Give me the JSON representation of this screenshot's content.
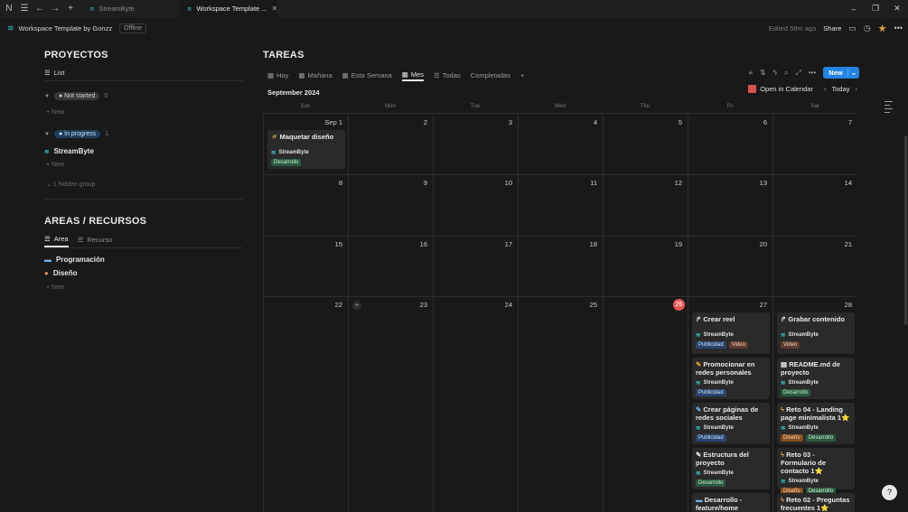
{
  "titlebar": {
    "tabs": [
      {
        "label": "StreamByte",
        "active": false
      },
      {
        "label": "Workspace Template ...",
        "active": true
      }
    ],
    "controls": [
      "–",
      "❐",
      "✕"
    ]
  },
  "header": {
    "workspace": "Workspace Template by Gonzz",
    "status": "Offline",
    "edited": "Edited 58m ago",
    "share": "Share"
  },
  "proyectos": {
    "title": "PROYECTOS",
    "view": "List",
    "groups": [
      {
        "status": "Not started",
        "count": "0",
        "items": [],
        "new": "New"
      },
      {
        "status": "In progress",
        "count": "1",
        "items": [
          "StreamByte"
        ],
        "new": "New"
      }
    ],
    "hidden": "1 hidden group"
  },
  "areas": {
    "title": "AREAS / RECURSOS",
    "tabs": [
      "Area",
      "Recurso"
    ],
    "items": [
      {
        "label": "Programación",
        "icon": "laptop-icon"
      },
      {
        "label": "Diseño",
        "icon": "palette-icon"
      }
    ],
    "new": "New"
  },
  "tareas": {
    "title": "TAREAS",
    "tabs": [
      "Hoy",
      "Mañana",
      "Esta Semana",
      "Mes",
      "Todas",
      "Completadas"
    ],
    "active_tab": "Mes",
    "new_button": "New",
    "month": "September 2024",
    "open_calendar": "Open in Calendar",
    "today": "Today",
    "weekdays": [
      "Sun",
      "Mon",
      "Tue",
      "Wed",
      "Thu",
      "Fri",
      "Sat"
    ],
    "weeks": [
      [
        "Sep 1",
        "2",
        "3",
        "4",
        "5",
        "6",
        "7"
      ],
      [
        "8",
        "9",
        "10",
        "11",
        "12",
        "13",
        "14"
      ],
      [
        "15",
        "16",
        "17",
        "18",
        "19",
        "20",
        "21"
      ],
      [
        "22",
        "23",
        "24",
        "25",
        "26",
        "27",
        "28"
      ]
    ],
    "cards": {
      "sep1": [
        {
          "title": "Maquetar diseño",
          "rel": "StreamByte",
          "tags": [
            "Desarrollo"
          ]
        }
      ],
      "fri27": [
        {
          "title": "Crear reel",
          "rel": "StreamByte",
          "tags": [
            "Publicidad",
            "Video"
          ]
        },
        {
          "title": "Promocionar en redes personales",
          "rel": "StreamByte",
          "tags": [
            "Publicidad"
          ]
        },
        {
          "title": "Crear páginas de redes sociales",
          "rel": "StreamByte",
          "tags": [
            "Publicidad"
          ]
        },
        {
          "title": "Estructura del proyecto",
          "rel": "StreamByte",
          "tags": [
            "Desarrollo"
          ]
        },
        {
          "title": "Desarrollo - feature/home",
          "rel": "",
          "tags": []
        }
      ],
      "sat28": [
        {
          "title": "Grabar contenido",
          "rel": "StreamByte",
          "tags": [
            "Video"
          ]
        },
        {
          "title": "README.md de proyecto",
          "rel": "StreamByte",
          "tags": [
            "Desarrollo"
          ]
        },
        {
          "title": "Reto 04 - Landing page minimalista 1⭐",
          "rel": "StreamByte",
          "tags": [
            "Diseño",
            "Desarrollo"
          ]
        },
        {
          "title": "Reto 03 - Formulario de contacto 1⭐",
          "rel": "StreamByte",
          "tags": [
            "Diseño",
            "Desarrollo"
          ]
        },
        {
          "title": "Reto 02 - Preguntas frecuentes 1⭐",
          "rel": "",
          "tags": []
        }
      ]
    }
  }
}
